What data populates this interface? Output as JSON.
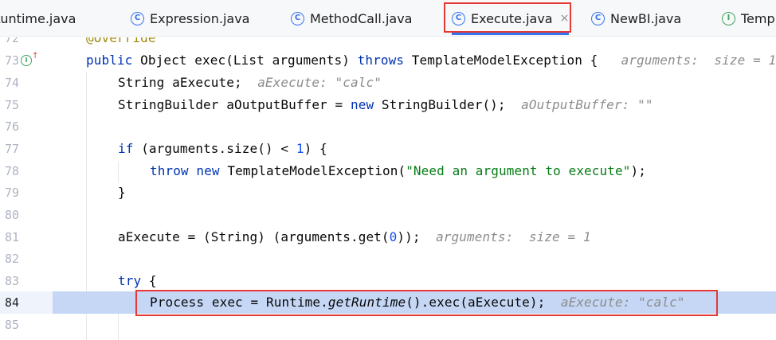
{
  "tabs": [
    {
      "label": "Runtime.java",
      "icon": "class-icon",
      "glyph": "C"
    },
    {
      "label": "Expression.java",
      "icon": "class-icon",
      "glyph": "C"
    },
    {
      "label": "MethodCall.java",
      "icon": "class-icon",
      "glyph": "C"
    },
    {
      "label": "Execute.java",
      "icon": "class-icon",
      "glyph": "C",
      "active": true,
      "close": "×"
    },
    {
      "label": "NewBI.java",
      "icon": "class-icon",
      "glyph": "C"
    },
    {
      "label": "Temp",
      "icon": "interface-icon",
      "glyph": "I"
    }
  ],
  "colors": {
    "accent": "#3574f0",
    "highlight_box": "#e53935",
    "current_line": "#c5d7f5",
    "keyword": "#0033b3",
    "string": "#067d17",
    "number": "#1750eb",
    "inline_hint": "#8c8c8c"
  },
  "editor": {
    "current_line": "84",
    "lines": [
      {
        "n": "72",
        "anno": "@Override"
      },
      {
        "n": "73",
        "kw1": "public",
        "t1": " Object exec(List arguments) ",
        "kw2": "throws",
        "t2": " TemplateModelException {",
        "hint": "arguments:  size = 1"
      },
      {
        "n": "74",
        "t1": "String aExecute;",
        "hint": "aExecute: \"calc\""
      },
      {
        "n": "75",
        "t1": "StringBuilder aOutputBuffer = ",
        "kw": "new",
        "t2": " StringBuilder();",
        "hint": "aOutputBuffer: \"\""
      },
      {
        "n": "76"
      },
      {
        "n": "77",
        "kw": "if",
        "t1": " (arguments.size() < ",
        "num": "1",
        "t2": ") {"
      },
      {
        "n": "78",
        "kw1": "throw",
        "kw2": "new",
        "t1": " TemplateModelException(",
        "str": "\"Need an argument to execute\"",
        "t2": ");"
      },
      {
        "n": "79",
        "t1": "}"
      },
      {
        "n": "80"
      },
      {
        "n": "81",
        "t1": "aExecute = (String) (arguments.get(",
        "num": "0",
        "t2": "));",
        "hint": "arguments:  size = 1"
      },
      {
        "n": "82"
      },
      {
        "n": "83",
        "kw": "try",
        "t1": " {"
      },
      {
        "n": "84",
        "t1": "Process exec = Runtime.",
        "it": "getRuntime",
        "t2": "().exec(aExecute);",
        "hint": "aExecute: \"calc\""
      },
      {
        "n": "85"
      }
    ]
  }
}
